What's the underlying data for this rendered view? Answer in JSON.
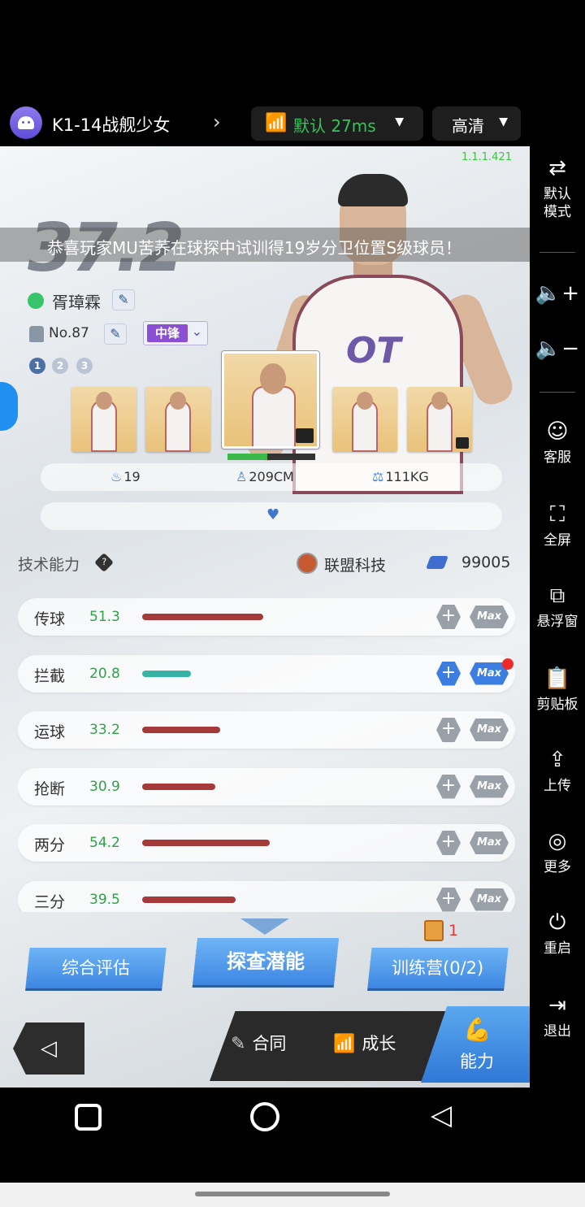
{
  "app": {
    "title": "K1-14战舰少女",
    "network": "默认 27ms",
    "quality": "高清"
  },
  "game": {
    "version": "1.1.1.421",
    "rating": "37.2",
    "marquee": "恭喜玩家MU苦荞在球探中试训得19岁分卫位置S级球员！",
    "player": {
      "name": "胥璋霖",
      "number": "No.87",
      "position": "中锋",
      "jersey_text": "OT",
      "pages": [
        "1",
        "2",
        "3"
      ],
      "age": "19",
      "height": "209CM",
      "weight": "111KG",
      "card_progress": 0.45
    },
    "skills_header": {
      "title": "技术能力",
      "help": "?",
      "org_name": "联盟科技",
      "currency": "99005"
    },
    "skills": [
      {
        "name": "传球",
        "value": "51.3",
        "level": 0.513,
        "active": false
      },
      {
        "name": "拦截",
        "value": "20.8",
        "level": 0.208,
        "active": true
      },
      {
        "name": "运球",
        "value": "33.2",
        "level": 0.332,
        "active": false
      },
      {
        "name": "抢断",
        "value": "30.9",
        "level": 0.309,
        "active": false
      },
      {
        "name": "两分",
        "value": "54.2",
        "level": 0.542,
        "active": false
      },
      {
        "name": "三分",
        "value": "39.5",
        "level": 0.395,
        "active": false
      }
    ],
    "max_label": "Max",
    "plus_label": "+",
    "ticket_count": "1",
    "buttons": {
      "eval": "综合评估",
      "explore": "探查潜能",
      "camp": "训练营(0/2)"
    },
    "nav": {
      "back": "◁",
      "contract": "合同",
      "growth": "成长",
      "ability": "能力"
    }
  },
  "toolbar": [
    {
      "icon": "swap-icon",
      "glyph": "⇄",
      "label": "默认\n模式"
    },
    {
      "icon": "volume-up-icon",
      "glyph": "🔈+",
      "label": ""
    },
    {
      "icon": "volume-down-icon",
      "glyph": "🔈−",
      "label": ""
    },
    {
      "icon": "support-icon",
      "glyph": "☺",
      "label": "客服"
    },
    {
      "icon": "fullscreen-icon",
      "glyph": "⛶",
      "label": "全屏"
    },
    {
      "icon": "float-window-icon",
      "glyph": "⧉",
      "label": "悬浮窗"
    },
    {
      "icon": "clipboard-icon",
      "glyph": "📋",
      "label": "剪贴板"
    },
    {
      "icon": "upload-icon",
      "glyph": "⇪",
      "label": "上传"
    },
    {
      "icon": "more-icon",
      "glyph": "◎",
      "label": "更多"
    },
    {
      "icon": "power-icon",
      "glyph": "⏻",
      "label": "重启"
    },
    {
      "icon": "exit-icon",
      "glyph": "⇥",
      "label": "退出"
    }
  ]
}
